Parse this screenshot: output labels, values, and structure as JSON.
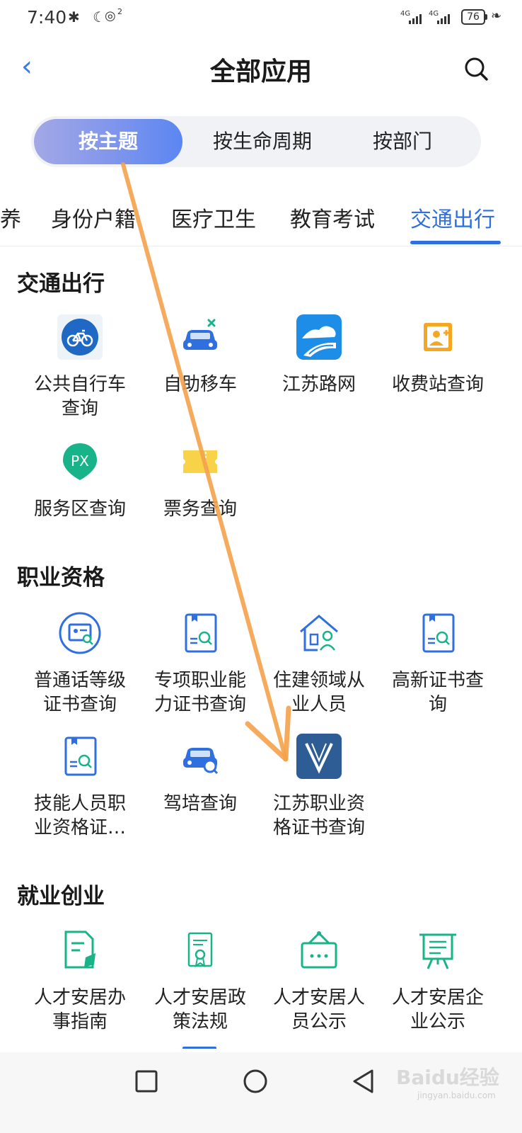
{
  "status_bar": {
    "time": "7:40",
    "left_icons": "✱ ☾",
    "hotspot_count": "2",
    "signal1": "4G",
    "signal2": "4G",
    "battery": "76"
  },
  "header": {
    "title": "全部应用",
    "back_icon": "chevron-left-icon",
    "search_icon": "search-icon"
  },
  "segments": {
    "active": "按主题",
    "items": [
      "按主题",
      "按生命周期",
      "按部门"
    ]
  },
  "categories": {
    "items": [
      "养",
      "身份户籍",
      "医疗卫生",
      "教育考试",
      "交通出行"
    ],
    "active": "交通出行",
    "accent": "#2f6fe0"
  },
  "sections": [
    {
      "title": "交通出行",
      "apps": [
        {
          "label": "公共自行车\n查询",
          "icon": "bicycle-icon"
        },
        {
          "label": "自助移车",
          "icon": "car-icon"
        },
        {
          "label": "江苏路网",
          "icon": "road-network-icon"
        },
        {
          "label": "收费站查询",
          "icon": "toll-station-icon"
        },
        {
          "label": "服务区查询",
          "icon": "service-area-icon"
        },
        {
          "label": "票务查询",
          "icon": "ticket-icon"
        }
      ]
    },
    {
      "title": "职业资格",
      "apps": [
        {
          "label": "普通话等级\n证书查询",
          "icon": "id-card-search-icon"
        },
        {
          "label": "专项职业能\n力证书查询",
          "icon": "certificate-book-icon"
        },
        {
          "label": "住建领域从\n业人员",
          "icon": "house-person-icon"
        },
        {
          "label": "高新证书查\n询",
          "icon": "certificate-book-icon"
        },
        {
          "label": "技能人员职\n业资格证…",
          "icon": "certificate-book-icon"
        },
        {
          "label": "驾培查询",
          "icon": "car-search-icon"
        },
        {
          "label": "江苏职业资\n格证书查询",
          "icon": "v-logo-icon"
        }
      ]
    },
    {
      "title": "就业创业",
      "apps": [
        {
          "label": "人才安居办\n事指南",
          "icon": "document-edit-icon"
        },
        {
          "label": "人才安居政\n策法规",
          "icon": "award-document-icon"
        },
        {
          "label": "人才安居人\n员公示",
          "icon": "notice-board-icon"
        },
        {
          "label": "人才安居企\n业公示",
          "icon": "easel-board-icon"
        }
      ]
    }
  ],
  "nav": {
    "recent_icon": "square-recent-icon",
    "home_icon": "circle-home-icon",
    "back_icon": "triangle-back-icon"
  },
  "watermark": {
    "brand": "Baidu经验",
    "url": "jingyan.baidu.com"
  },
  "colors": {
    "teal": "#19b38a",
    "blue": "#2f6fe0",
    "arrow": "#f6a24b"
  }
}
